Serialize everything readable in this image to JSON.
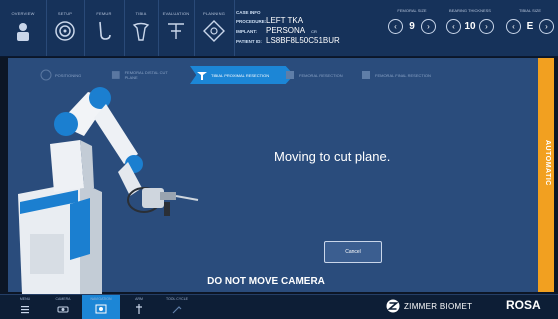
{
  "topnav": [
    {
      "label": "Overview",
      "icon": "person-icon"
    },
    {
      "label": "Setup",
      "icon": "target-icon"
    },
    {
      "label": "Femur",
      "icon": "femur-icon"
    },
    {
      "label": "Tibia",
      "icon": "tibia-icon"
    },
    {
      "label": "Evaluation",
      "icon": "evaluation-icon"
    },
    {
      "label": "Planning",
      "icon": "planning-icon"
    }
  ],
  "case_info": {
    "header": "CASE INFO",
    "procedure_key": "PROCEDURE:",
    "procedure": "LEFT TKA",
    "implant_key": "IMPLANT:",
    "implant": "PERSONA",
    "patient_key": "PATIENT ID:",
    "patient_id": "LS8BF8L50C51BUR",
    "flag": "CR"
  },
  "counters": [
    {
      "label": "Femoral Size",
      "value": "9"
    },
    {
      "label": "Bearing Thickness",
      "value": "10"
    },
    {
      "label": "Tibial Size",
      "value": "E"
    }
  ],
  "workflow_steps": [
    {
      "label": "Positioning",
      "state": "done"
    },
    {
      "label": "Femoral Distal Cut Plane",
      "state": "done"
    },
    {
      "label": "Tibial Proximal Resection",
      "state": "active"
    },
    {
      "label": "Femoral Resection",
      "state": "todo"
    },
    {
      "label": "Femoral Final Resection",
      "state": "todo"
    }
  ],
  "main": {
    "message": "Moving to cut plane.",
    "cancel_label": "Cancel",
    "warning": "DO NOT MOVE CAMERA",
    "mode": "AUTOMATIC"
  },
  "bottomnav": [
    {
      "label": "Menu",
      "icon": "menu-icon"
    },
    {
      "label": "Camera",
      "icon": "camera-icon"
    },
    {
      "label": "Navigation",
      "icon": "navigation-icon"
    },
    {
      "label": "Arm",
      "icon": "robot-arm-icon"
    },
    {
      "label": "Tool Cycle",
      "icon": "tool-icon"
    }
  ],
  "brand": {
    "name": "ZIMMER BIOMET",
    "product": "ROSA"
  },
  "colors": {
    "accent": "#1c86d6",
    "mode_bar": "#f2a020",
    "panel": "#2a4c7c",
    "topbar": "#16325a"
  }
}
